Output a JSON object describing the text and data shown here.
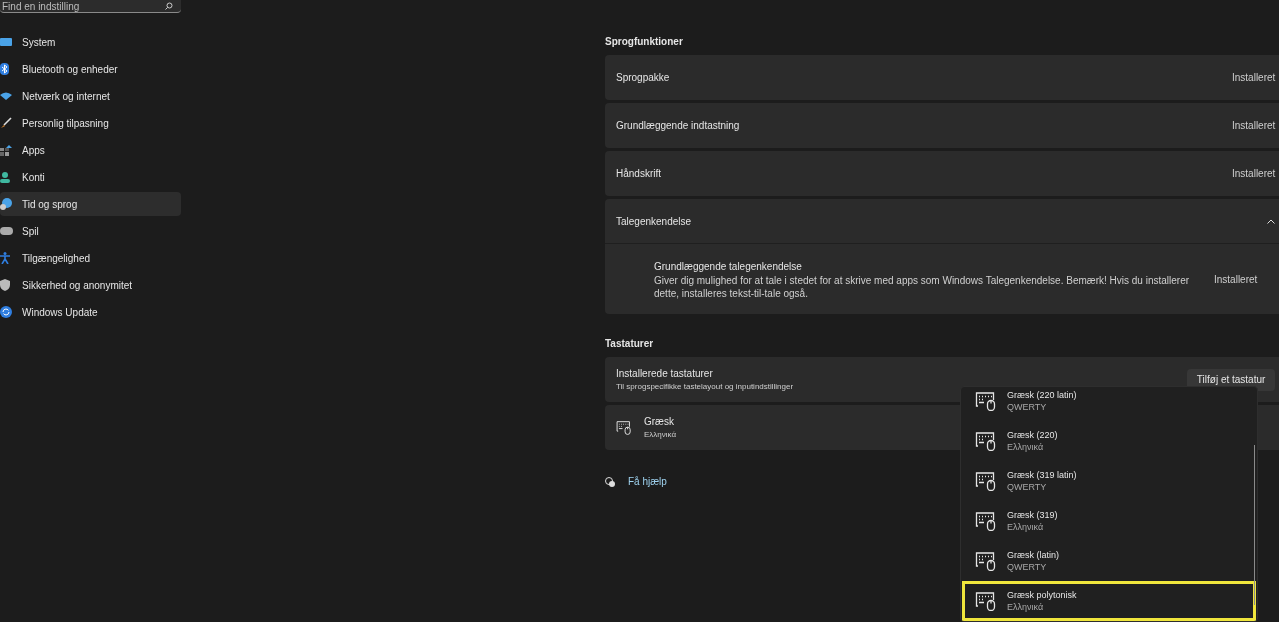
{
  "search": {
    "placeholder": "Find en indstilling"
  },
  "sidebar": {
    "items": [
      {
        "label": "System",
        "selected": false
      },
      {
        "label": "Bluetooth og enheder",
        "selected": false
      },
      {
        "label": "Netværk og internet",
        "selected": false
      },
      {
        "label": "Personlig tilpasning",
        "selected": false
      },
      {
        "label": "Apps",
        "selected": false
      },
      {
        "label": "Konti",
        "selected": false
      },
      {
        "label": "Tid og sprog",
        "selected": true
      },
      {
        "label": "Spil",
        "selected": false
      },
      {
        "label": "Tilgængelighed",
        "selected": false
      },
      {
        "label": "Sikkerhed og anonymitet",
        "selected": false
      },
      {
        "label": "Windows Update",
        "selected": false
      }
    ]
  },
  "language_features": {
    "heading": "Sprogfunktioner",
    "rows": [
      {
        "label": "Sprogpakke",
        "status": "Installeret"
      },
      {
        "label": "Grundlæggende indtastning",
        "status": "Installeret"
      },
      {
        "label": "Håndskrift",
        "status": "Installeret"
      }
    ],
    "speech": {
      "label": "Talegenkendelse",
      "expanded": true,
      "item": {
        "title": "Grundlæggende talegenkendelse",
        "description": "Giver dig mulighed for at tale i stedet for at skrive med apps som Windows Talegenkendelse. Bemærk! Hvis du installerer dette, installeres tekst-til-tale også.",
        "status": "Installeret"
      }
    }
  },
  "keyboards": {
    "heading": "Tastaturer",
    "installed": {
      "title": "Installerede tastaturer",
      "subtitle": "Til sprogspecifikke tastelayout og inputindstillinger",
      "button": "Tilføj et tastatur"
    },
    "items": [
      {
        "name": "Græsk",
        "subtitle": "Ελληνικά"
      }
    ]
  },
  "help_link": "Få hjælp",
  "dropdown": {
    "items": [
      {
        "name": "Græsk (220 latin)",
        "subtitle": "QWERTY",
        "selected": false
      },
      {
        "name": "Græsk (220)",
        "subtitle": "Ελληνικά",
        "selected": false
      },
      {
        "name": "Græsk (319 latin)",
        "subtitle": "QWERTY",
        "selected": false
      },
      {
        "name": "Græsk (319)",
        "subtitle": "Ελληνικά",
        "selected": false
      },
      {
        "name": "Græsk (latin)",
        "subtitle": "QWERTY",
        "selected": false
      },
      {
        "name": "Græsk polytonisk",
        "subtitle": "Ελληνικά",
        "selected": true
      }
    ]
  }
}
